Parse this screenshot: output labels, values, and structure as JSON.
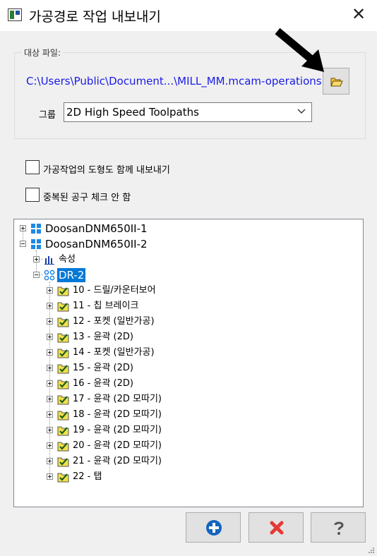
{
  "window": {
    "title": "가공경로 작업 내보내기",
    "close_glyph": "✕"
  },
  "target_file": {
    "group_label": "대상 파일:",
    "path": "C:\\Users\\Public\\Document...\\MILL_MM.mcam-operations",
    "browse_icon": "open-folder-icon"
  },
  "group": {
    "label": "그룹",
    "selected": "2D High Speed Toolpaths"
  },
  "options": [
    {
      "label": "가공작업의 도형도 함께 내보내기",
      "checked": false
    },
    {
      "label": "중복된 공구 체크 안 함",
      "checked": false
    }
  ],
  "tree": {
    "machines": [
      {
        "label": "DoosanDNM650II-1",
        "expanded": false
      },
      {
        "label": "DoosanDNM650II-2",
        "expanded": true
      }
    ],
    "properties_label": "속성",
    "group_node": {
      "label": "DR-2",
      "selected": true
    },
    "operations": [
      {
        "label": "10 - 드릴/카운터보어"
      },
      {
        "label": "11 - 칩 브레이크"
      },
      {
        "label": "12 - 포켓 (일반가공)"
      },
      {
        "label": "13 - 윤곽 (2D)"
      },
      {
        "label": "14 - 포켓 (일반가공)"
      },
      {
        "label": "15 - 윤곽 (2D)"
      },
      {
        "label": "16 - 윤곽 (2D)"
      },
      {
        "label": "17 - 윤곽 (2D 모따기)"
      },
      {
        "label": "18 - 윤곽 (2D 모따기)"
      },
      {
        "label": "19 - 윤곽 (2D 모따기)"
      },
      {
        "label": "20 - 윤곽 (2D 모따기)"
      },
      {
        "label": "21 - 윤곽 (2D 모따기)"
      },
      {
        "label": "22 - 탭"
      }
    ]
  },
  "buttons": {
    "ok_icon": "plus-circle-icon",
    "cancel_icon": "red-x-icon",
    "help_icon": "question-mark-icon"
  },
  "colors": {
    "path_link": "#1a1ae6",
    "selection": "#0078d7",
    "folder_green": "#2e7d32",
    "ok_blue": "#1565c0",
    "cancel_red": "#e53935"
  }
}
